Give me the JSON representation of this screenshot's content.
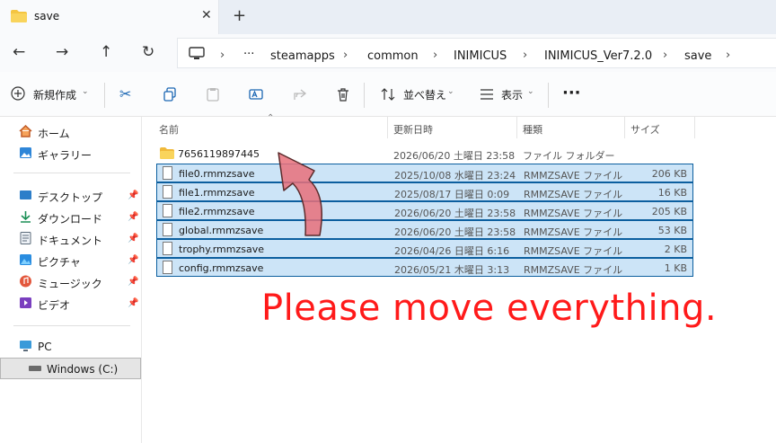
{
  "window": {
    "tab_title": "save",
    "close": "✕",
    "new_tab": "+"
  },
  "nav": {
    "back": "←",
    "forward": "→",
    "up": "↑",
    "refresh": "↻"
  },
  "breadcrumb": {
    "more": "···",
    "items": [
      "steamapps",
      "common",
      "INIMICUS",
      "INIMICUS_Ver7.2.0",
      "save"
    ],
    "sep": "›"
  },
  "toolbar": {
    "new_label": "新規作成",
    "sort_label": "並べ替え",
    "view_label": "表示",
    "more": "···"
  },
  "sidebar": {
    "quick": [
      {
        "label": "ホーム",
        "icon": "home-icon"
      },
      {
        "label": "ギャラリー",
        "icon": "gallery-icon"
      }
    ],
    "pinned": [
      {
        "label": "デスクトップ",
        "icon": "desktop-icon"
      },
      {
        "label": "ダウンロード",
        "icon": "download-icon"
      },
      {
        "label": "ドキュメント",
        "icon": "document-icon"
      },
      {
        "label": "ピクチャ",
        "icon": "pictures-icon"
      },
      {
        "label": "ミュージック",
        "icon": "music-icon"
      },
      {
        "label": "ビデオ",
        "icon": "video-icon"
      }
    ],
    "pc": {
      "label": "PC",
      "icon": "pc-icon"
    },
    "drive": {
      "label": "Windows (C:)",
      "icon": "drive-icon"
    }
  },
  "columns": {
    "name": "名前",
    "date": "更新日時",
    "type": "種類",
    "size": "サイズ"
  },
  "files": [
    {
      "name": "7656119897445",
      "date": "2026/06/20 土曜日 23:58",
      "type": "ファイル フォルダー",
      "size": "",
      "folder": true
    },
    {
      "name": "file0.rmmzsave",
      "date": "2025/10/08 水曜日 23:24",
      "type": "RMMZSAVE ファイル",
      "size": "206 KB"
    },
    {
      "name": "file1.rmmzsave",
      "date": "2025/08/17 日曜日 0:09",
      "type": "RMMZSAVE ファイル",
      "size": "16 KB"
    },
    {
      "name": "file2.rmmzsave",
      "date": "2026/06/20 土曜日 23:58",
      "type": "RMMZSAVE ファイル",
      "size": "205 KB"
    },
    {
      "name": "global.rmmzsave",
      "date": "2026/06/20 土曜日 23:58",
      "type": "RMMZSAVE ファイル",
      "size": "53 KB"
    },
    {
      "name": "trophy.rmmzsave",
      "date": "2026/04/26 日曜日 6:16",
      "type": "RMMZSAVE ファイル",
      "size": "2 KB"
    },
    {
      "name": "config.rmmzsave",
      "date": "2026/05/21 木曜日 3:13",
      "type": "RMMZSAVE ファイル",
      "size": "1 KB"
    }
  ],
  "overlay": {
    "message": "Please move everything."
  },
  "colors": {
    "accent": "#0c5f9f",
    "selection": "#cce4f7",
    "arrow": "#e8707a",
    "message": "#ff1a1a",
    "folder": "#f4c542"
  }
}
